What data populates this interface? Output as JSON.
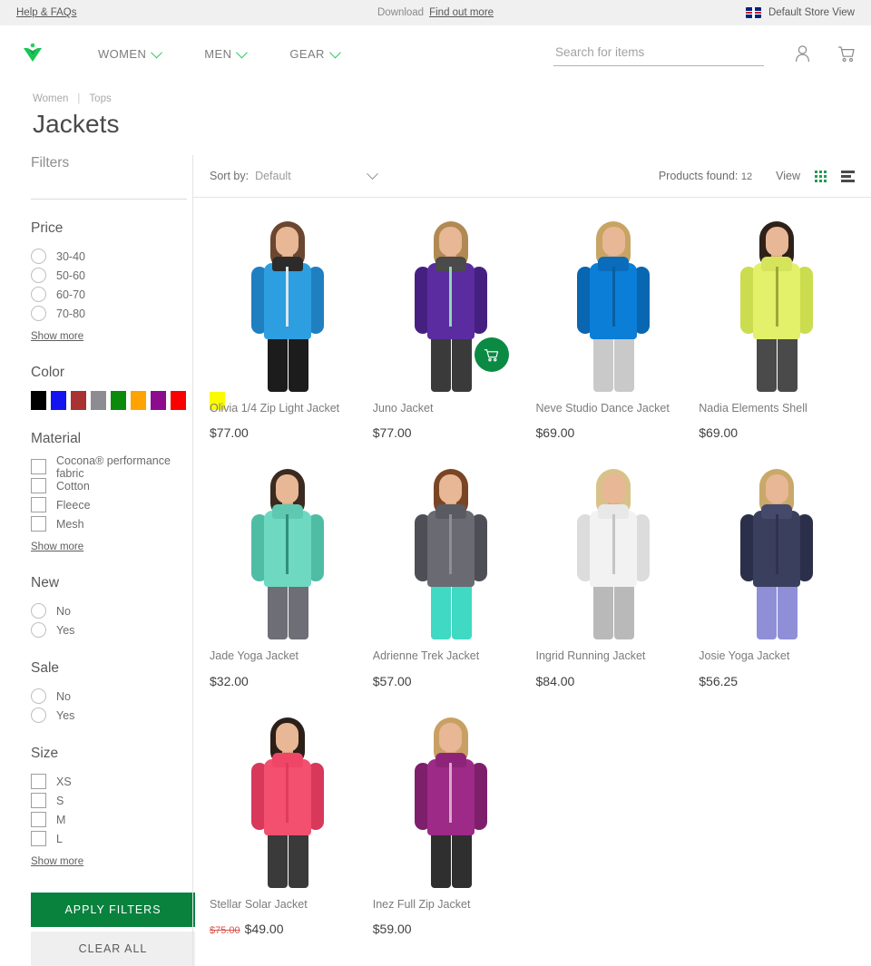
{
  "top_bar": {
    "help_link": "Help & FAQs",
    "download_label": "Download",
    "download_link": "Find out more",
    "store_view": "Default Store View",
    "flag_icon": "uk-flag-icon"
  },
  "header": {
    "logo_icon": "brand-chevron-logo",
    "nav": [
      {
        "label": "WOMEN",
        "icon": "chevron-down-icon"
      },
      {
        "label": "MEN",
        "icon": "chevron-down-icon"
      },
      {
        "label": "GEAR",
        "icon": "chevron-down-icon"
      }
    ],
    "search": {
      "placeholder": "Search for items",
      "value": ""
    },
    "account_icon": "user-account-icon",
    "cart_icon": "shopping-cart-icon"
  },
  "breadcrumb": {
    "items": [
      "Women",
      "Tops"
    ],
    "separator": "|"
  },
  "page_title": "Jackets",
  "sidebar": {
    "heading": "Filters",
    "show_more_label": "Show more",
    "apply_label": "APPLY FILTERS",
    "clear_label": "CLEAR ALL",
    "groups": [
      {
        "title": "Price",
        "type": "radio",
        "options": [
          "30-40",
          "50-60",
          "60-70",
          "70-80"
        ],
        "show_more": true
      },
      {
        "title": "Color",
        "type": "swatch",
        "colors": [
          {
            "name": "black",
            "hex": "#000000"
          },
          {
            "name": "blue",
            "hex": "#1414f0"
          },
          {
            "name": "brown",
            "hex": "#a93232"
          },
          {
            "name": "gray",
            "hex": "#8c8c92"
          },
          {
            "name": "green",
            "hex": "#0c8a0c"
          },
          {
            "name": "orange",
            "hex": "#ffa300"
          },
          {
            "name": "purple",
            "hex": "#8d0c8d"
          },
          {
            "name": "red",
            "hex": "#fb0000"
          },
          {
            "name": "yellow",
            "hex": "#fbfb00"
          }
        ],
        "show_more": false
      },
      {
        "title": "Material",
        "type": "checkbox",
        "options": [
          "Cocona® performance fabric",
          "Cotton",
          "Fleece",
          "Mesh"
        ],
        "show_more": true
      },
      {
        "title": "New",
        "type": "radio",
        "options": [
          "No",
          "Yes"
        ],
        "show_more": false
      },
      {
        "title": "Sale",
        "type": "radio",
        "options": [
          "No",
          "Yes"
        ],
        "show_more": false
      },
      {
        "title": "Size",
        "type": "checkbox",
        "options": [
          "XS",
          "S",
          "M",
          "L"
        ],
        "show_more": true
      }
    ]
  },
  "toolbar": {
    "sort_label": "Sort by:",
    "sort_value": "Default",
    "sort_caret_icon": "chevron-down-icon",
    "products_found_label": "Products found:",
    "products_found_count": "12",
    "view_label": "View",
    "grid_icon": "grid-view-icon",
    "list_icon": "list-view-icon",
    "active_view": "grid",
    "grid_icon_color": "#1f9d55"
  },
  "accent_color": "#08823d",
  "products": [
    {
      "name": "Olivia 1/4 Zip Light Jacket",
      "price": "$77.00",
      "old_price": "",
      "hovered": false,
      "image": {
        "jacket": "#2d9ee0",
        "jacket_dark": "#1f7fc0",
        "hair": "#6b4630",
        "pants": "#1c1c1c",
        "zip": "#d8e9f2",
        "collar": "#2b2b2b"
      }
    },
    {
      "name": "Juno Jacket",
      "price": "$77.00",
      "old_price": "",
      "hovered": true,
      "cart_icon": "add-to-cart-icon",
      "image": {
        "jacket": "#5b2ca0",
        "jacket_dark": "#452080",
        "hair": "#b08a52",
        "pants": "#3a3a3a",
        "zip": "#8fd6b5",
        "collar": "#4a4a4a"
      }
    },
    {
      "name": "Neve Studio Dance Jacket",
      "price": "$69.00",
      "old_price": "",
      "hovered": false,
      "image": {
        "jacket": "#0b7ed8",
        "jacket_dark": "#0966b0",
        "hair": "#c8a464",
        "pants": "#c9c9c9",
        "zip": "#0a5e9e",
        "collar": "#0b6cbb"
      }
    },
    {
      "name": "Nadia Elements Shell",
      "price": "$69.00",
      "old_price": "",
      "hovered": false,
      "image": {
        "jacket": "#e2f06a",
        "jacket_dark": "#cbdc4e",
        "hair": "#2e2119",
        "pants": "#4a4a4a",
        "zip": "#9aa83a",
        "collar": "#d6e45c"
      }
    },
    {
      "name": "Jade Yoga Jacket",
      "price": "$32.00",
      "old_price": "",
      "hovered": false,
      "image": {
        "jacket": "#6fd8c0",
        "jacket_dark": "#4fbda4",
        "hair": "#3b2a20",
        "pants": "#6e6e76",
        "zip": "#2f8f7a",
        "collar": "#5ec9b0"
      }
    },
    {
      "name": "Adrienne Trek Jacket",
      "price": "$57.00",
      "old_price": "",
      "hovered": false,
      "image": {
        "jacket": "#6a6a72",
        "jacket_dark": "#4e4e56",
        "hair": "#7a4524",
        "pants": "#3fd9c4",
        "zip": "#8e8e96",
        "collar": "#5a5a62"
      }
    },
    {
      "name": "Ingrid Running Jacket",
      "price": "$84.00",
      "old_price": "",
      "hovered": false,
      "image": {
        "jacket": "#f2f2f2",
        "jacket_dark": "#dcdcdc",
        "hair": "#d8c28a",
        "pants": "#b9b9b9",
        "zip": "#c4c4c4",
        "collar": "#e8e8e8"
      }
    },
    {
      "name": "Josie Yoga Jacket",
      "price": "$56.25",
      "old_price": "",
      "hovered": false,
      "image": {
        "jacket": "#3b3f5e",
        "jacket_dark": "#2b2f4a",
        "hair": "#c9a96a",
        "pants": "#8f8fd8",
        "zip": "#2f3350",
        "collar": "#454a6b"
      }
    },
    {
      "name": "Stellar Solar Jacket",
      "price": "$49.00",
      "old_price": "$75.00",
      "hovered": false,
      "image": {
        "jacket": "#f2506e",
        "jacket_dark": "#d8385a",
        "hair": "#2b1f18",
        "pants": "#3a3a3a",
        "zip": "#e03a5e",
        "collar": "#ef4566"
      }
    },
    {
      "name": "Inez Full Zip Jacket",
      "price": "$59.00",
      "old_price": "",
      "hovered": false,
      "image": {
        "jacket": "#9c2a86",
        "jacket_dark": "#7e1f6c",
        "hair": "#c9a064",
        "pants": "#2f2f2f",
        "zip": "#d9a8cc",
        "collar": "#8e2479"
      }
    }
  ]
}
